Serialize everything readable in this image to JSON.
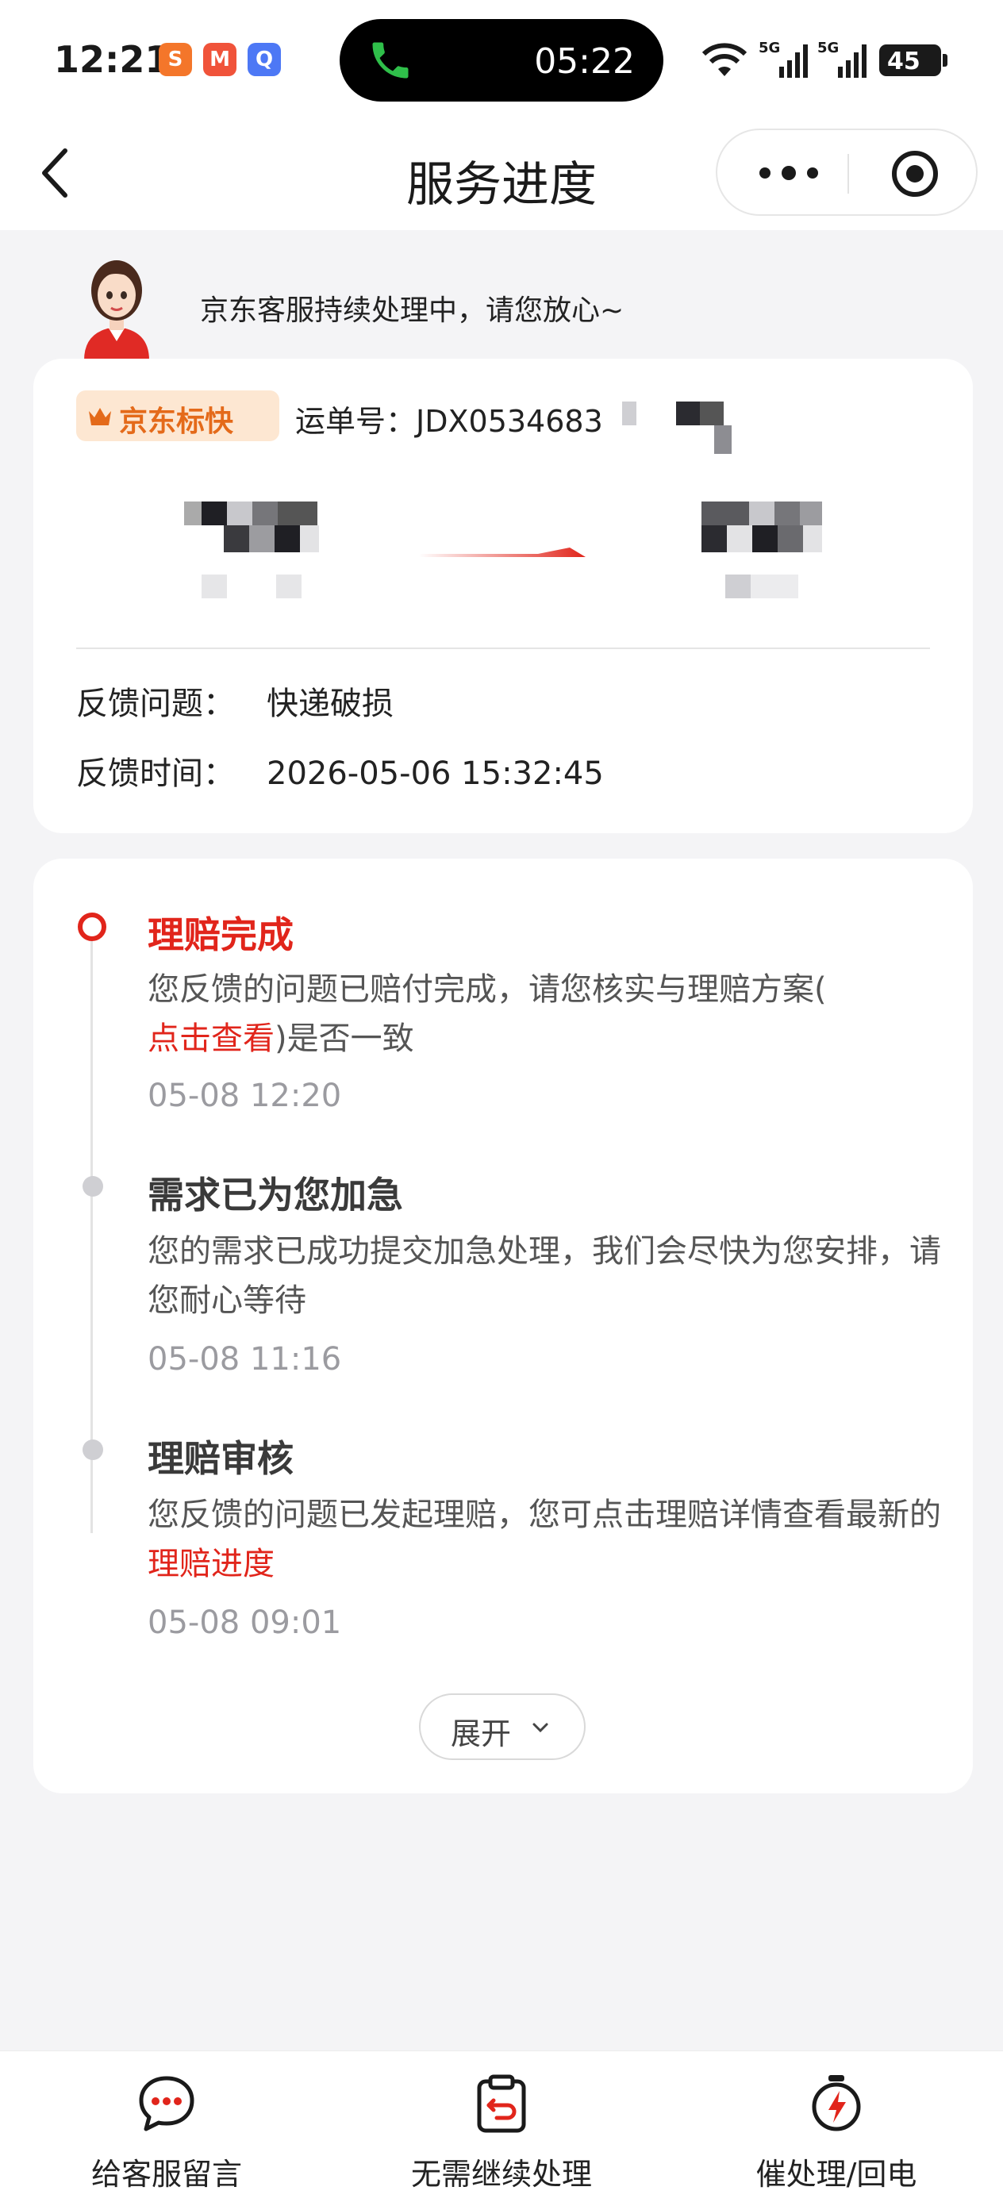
{
  "status_bar": {
    "time": "12:21",
    "app_icons": [
      "sohu-icon",
      "mgtv-icon",
      "qq-icon"
    ],
    "call_time": "05:22",
    "network": [
      "5G",
      "5G"
    ],
    "battery": "45"
  },
  "nav": {
    "title": "服务进度"
  },
  "banner": {
    "text": "京东客服持续处理中，请您放心~"
  },
  "shipment": {
    "carrier": "京东标快",
    "waybill_label": "运单号：",
    "waybill_number": "JDX0534683",
    "feedback_issue_label": "反馈问题：",
    "feedback_issue": "快递破损",
    "feedback_time_label": "反馈时间：",
    "feedback_time": "2026-05-06 15:32:45"
  },
  "timeline": {
    "items": [
      {
        "title": "理赔完成",
        "desc_prefix": "您反馈的问题已赔付完成，请您核实与理赔方案(",
        "desc_link": "点击查看",
        "desc_suffix": ")是否一致",
        "time": "05-08 12:20"
      },
      {
        "title": "需求已为您加急",
        "desc": "您的需求已成功提交加急处理，我们会尽快为您安排，请您耐心等待",
        "time": "05-08 11:16"
      },
      {
        "title": "理赔审核",
        "desc_prefix": "您反馈的问题已发起理赔，您可点击理赔详情查看最新的 ",
        "desc_link": "理赔进度",
        "time": "05-08 09:01"
      }
    ],
    "expand_label": "展开"
  },
  "bottom_bar": {
    "message_label": "给客服留言",
    "no_need_label": "无需继续处理",
    "urge_label": "催处理/回电"
  },
  "colors": {
    "accent": "#e1251b",
    "brand_orange": "#e46a1a",
    "background": "#f4f4f6"
  }
}
